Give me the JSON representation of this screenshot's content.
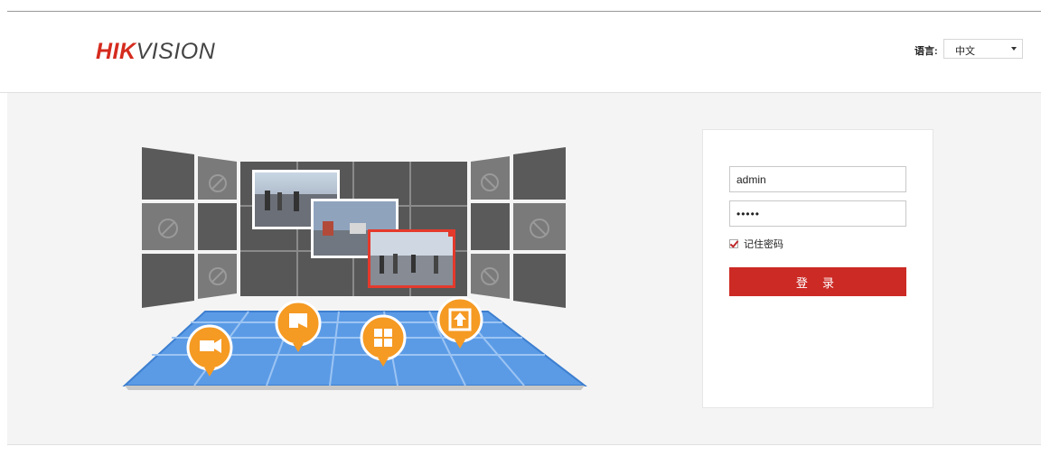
{
  "header": {
    "logo_red": "HIK",
    "logo_grey": "VISION",
    "language_label": "语言:",
    "language_selected": "中文"
  },
  "login": {
    "username_value": "admin",
    "password_value": "•••••",
    "remember_label": "记住密码",
    "remember_checked": true,
    "login_button": "登 录"
  },
  "colors": {
    "brand_red": "#cc2a25",
    "tile_dark": "#575757",
    "floor_blue": "#5b9be6",
    "pin_orange": "#f59a23"
  },
  "illustration": {
    "pins": [
      "camera-icon",
      "playback-icon",
      "grid-icon",
      "upload-icon"
    ]
  }
}
